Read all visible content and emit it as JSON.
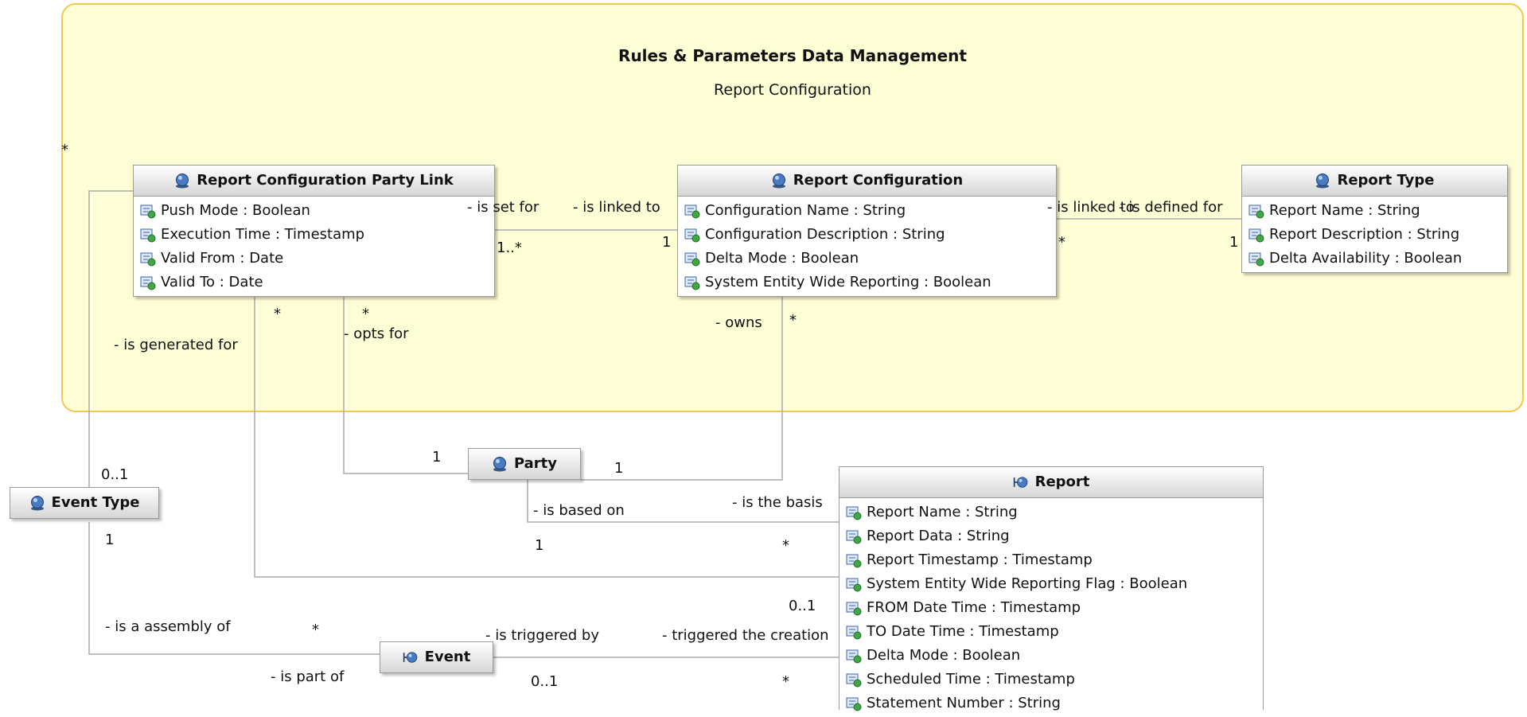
{
  "package": {
    "title": "Rules & Parameters Data Management",
    "subtitle": "Report Configuration"
  },
  "classes": {
    "rcpl": {
      "name": "Report Configuration Party Link",
      "attributes": [
        "Push Mode : Boolean",
        "Execution Time : Timestamp",
        "Valid From : Date",
        "Valid To : Date"
      ]
    },
    "rc": {
      "name": "Report Configuration",
      "attributes": [
        "Configuration Name : String",
        "Configuration Description : String",
        "Delta Mode : Boolean",
        "System Entity Wide Reporting : Boolean"
      ]
    },
    "rt": {
      "name": "Report Type",
      "attributes": [
        "Report Name : String",
        "Report Description : String",
        "Delta Availability : Boolean"
      ]
    },
    "party": {
      "name": "Party",
      "attributes": []
    },
    "event_type": {
      "name": "Event Type",
      "attributes": []
    },
    "event": {
      "name": "Event",
      "attributes": []
    },
    "report": {
      "name": "Report",
      "attributes": [
        "Report Name : String",
        "Report Data : String",
        "Report Timestamp : Timestamp",
        "System Entity Wide Reporting Flag : Boolean",
        "FROM Date Time : Timestamp",
        "TO Date Time : Timestamp",
        "Delta Mode : Boolean",
        "Scheduled Time : Timestamp",
        "Statement Number : String"
      ]
    }
  },
  "labels": {
    "star_top_left": "*",
    "is_set_for": "- is set for",
    "is_linked_to_1": "- is linked to",
    "mult_1_many": "1..*",
    "mult_1_rc_left": "1",
    "is_linked_to_2": "- is linked to",
    "is_defined_for": "- is defined for",
    "star_rc_right": "*",
    "mult_1_rt": "1",
    "star_rcpl_left": "*",
    "star_rcpl_mid": "*",
    "is_generated_for": "- is generated for",
    "opts_for": "- opts for",
    "owns": "- owns",
    "star_owns": "*",
    "mult_0_1_et": "0..1",
    "mult_1_party_left": "1",
    "mult_1_party_right": "1",
    "is_the_basis": "- is the basis",
    "is_based_on": "- is based on",
    "mult_1_et": "1",
    "mult_1_based": "1",
    "star_basis": "*",
    "mult_0_1_report": "0..1",
    "is_a_assembly_of": "- is a assembly of",
    "star_assembly": "*",
    "is_triggered_by": "- is triggered by",
    "triggered_the_creation": "- triggered the creation",
    "is_part_of": "- is part of",
    "mult_0_1_event": "0..1",
    "star_event_report": "*"
  },
  "colors": {
    "package_fill": "#fefed6",
    "package_border": "#f0c850",
    "line": "#aaaaaa"
  },
  "icons": {
    "class_icon": "entity-sphere-icon",
    "interface_icon": "boundary-icon",
    "attribute_icon": "attribute-icon"
  }
}
